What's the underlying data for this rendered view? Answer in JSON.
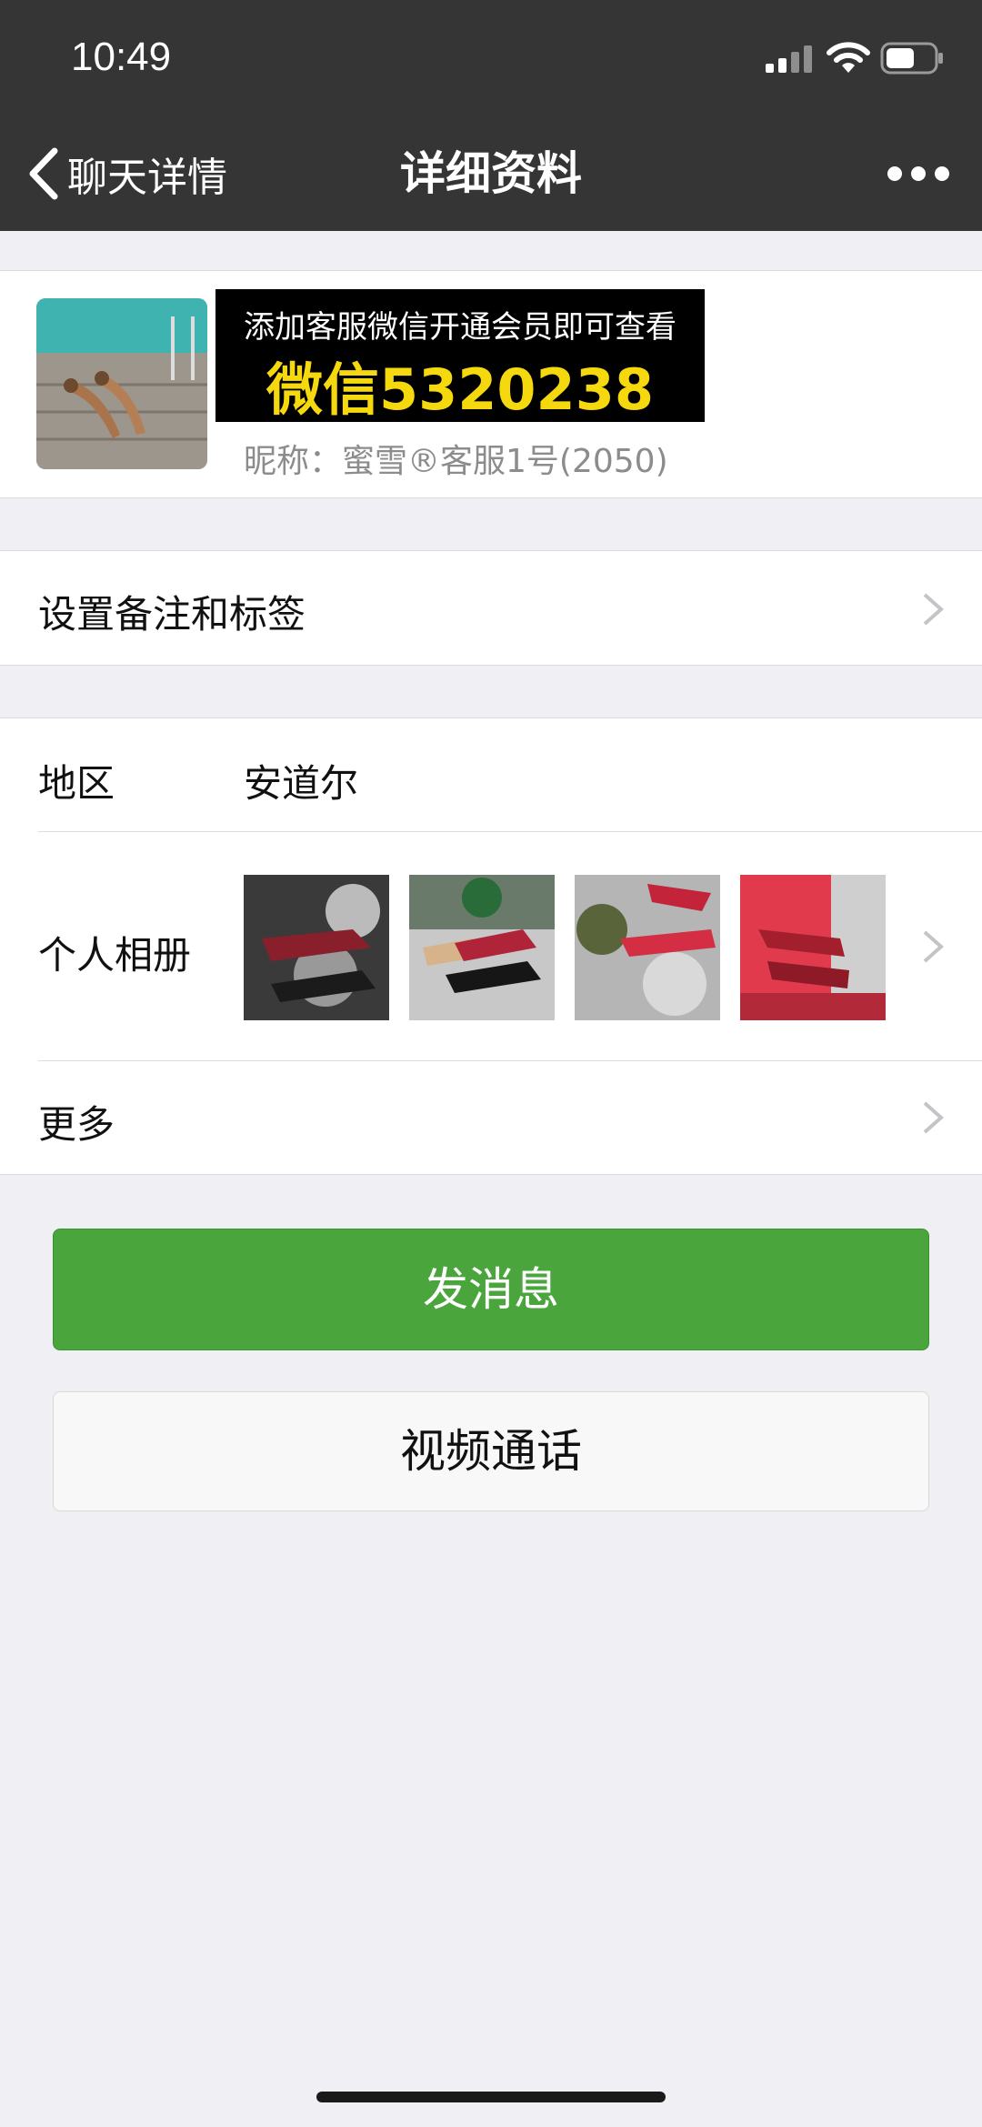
{
  "status_bar": {
    "time": "10:49"
  },
  "nav": {
    "back_label": "聊天详情",
    "title": "详细资料"
  },
  "profile": {
    "banner_line1": "添加客服微信开通会员即可查看",
    "banner_line2": "微信5320238",
    "nickname": "昵称：蜜雪®客服1号(2050)"
  },
  "rows": {
    "remark": "设置备注和标签",
    "region_label": "地区",
    "region_value": "安道尔",
    "album_label": "个人相册",
    "more": "更多"
  },
  "buttons": {
    "message": "发消息",
    "video_call": "视频通话"
  },
  "colors": {
    "nav_bg": "#353535",
    "page_bg": "#efeff4",
    "green": "#4aa53d",
    "banner_text": "#f5d90e"
  }
}
